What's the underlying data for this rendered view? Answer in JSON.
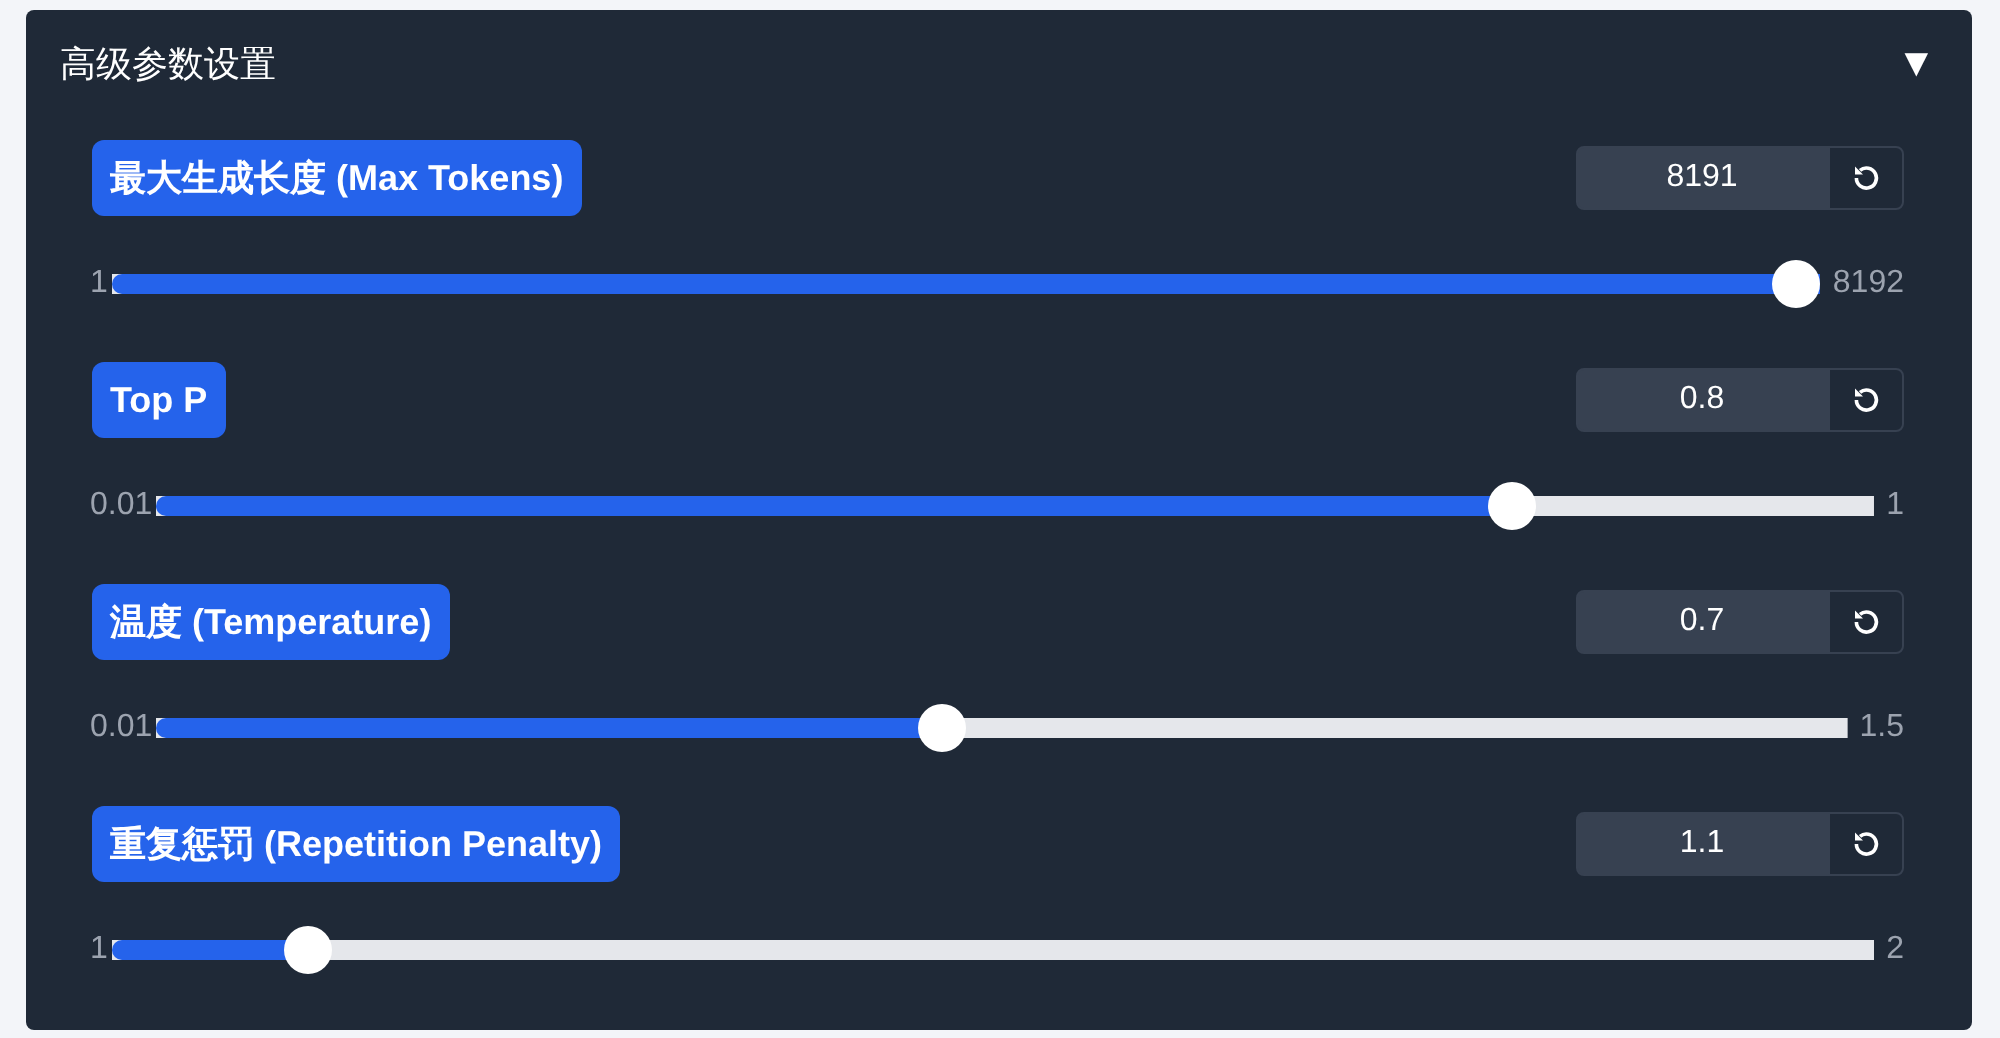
{
  "panel": {
    "title": "高级参数设置",
    "toggle": "▼",
    "expanded": true
  },
  "params": [
    {
      "label": "最大生成长度 (Max Tokens)",
      "value": "8191",
      "min": "1",
      "max": "8192",
      "level": 0.9999
    },
    {
      "label": "Top P",
      "value": "0.8",
      "min": "0.01",
      "max": "1",
      "level": 0.798
    },
    {
      "label": "温度 (Temperature)",
      "value": "0.7",
      "min": "0.01",
      "max": "1.5",
      "level": 0.463
    },
    {
      "label": "重复惩罚 (Repetition Penalty)",
      "value": "1.1",
      "min": "1",
      "max": "2",
      "level": 0.1
    }
  ]
}
